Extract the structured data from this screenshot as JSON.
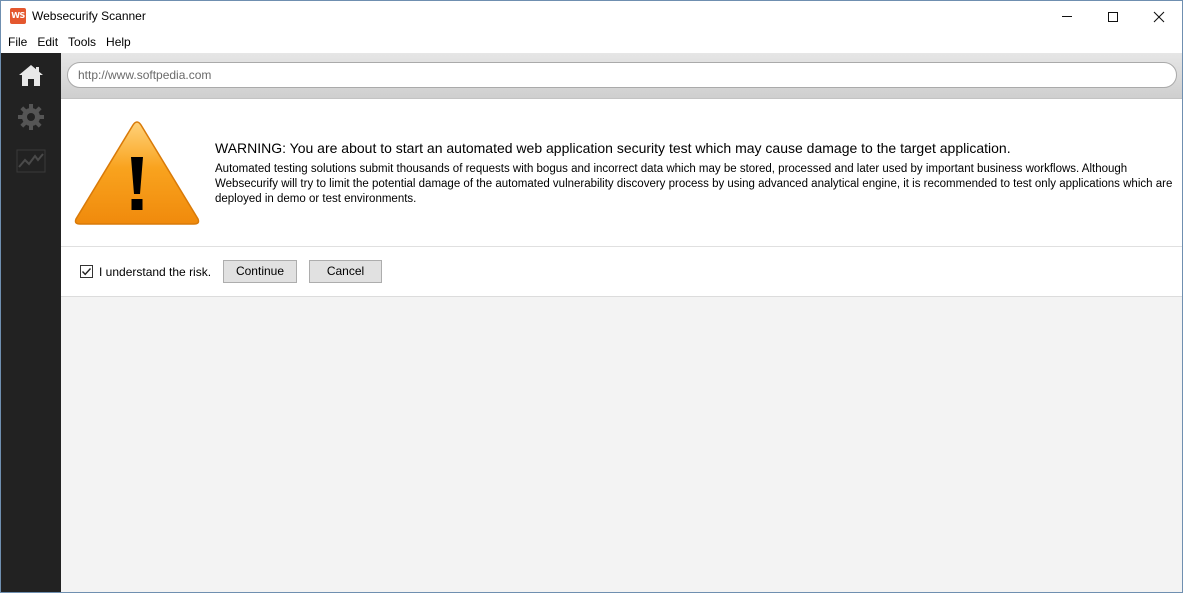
{
  "window": {
    "app_logo_text": "WS",
    "title": "Websecurify Scanner"
  },
  "menu": {
    "items": [
      "File",
      "Edit",
      "Tools",
      "Help"
    ]
  },
  "sidebar": {
    "icons": [
      "home-icon",
      "gear-icon",
      "activity-chart-icon"
    ]
  },
  "url_bar": {
    "value": "http://www.softpedia.com"
  },
  "warning": {
    "title": "WARNING: You are about to start an automated web application security test which may cause damage to the target application.",
    "body": "Automated testing solutions submit thousands of requests with bogus and incorrect data which may be stored, processed and later used by important business workflows. Although Websecurify will try to limit the potential damage of the automated vulnerability discovery process by using advanced analytical engine, it is recommended to test only applications which are deployed in demo or test environments."
  },
  "actions": {
    "checkbox_label": "I understand the risk.",
    "checkbox_checked": true,
    "continue_label": "Continue",
    "cancel_label": "Cancel"
  },
  "colors": {
    "sidebar_bg": "#222222",
    "warning_orange": "#f7a21b",
    "logo_red": "#e4572e"
  }
}
